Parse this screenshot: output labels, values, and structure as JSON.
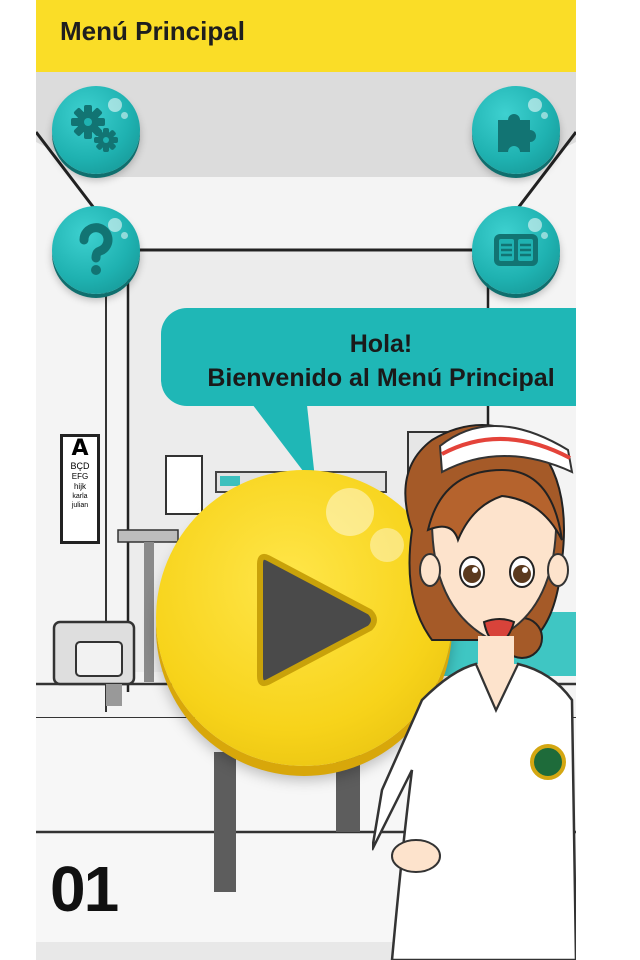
{
  "header": {
    "title": "Menú Principal"
  },
  "buttons": {
    "settings_icon": "gears-icon",
    "puzzle_icon": "puzzle-icon",
    "help_icon": "question-mark-icon",
    "book_icon": "book-icon"
  },
  "speech": {
    "line1": "Hola!",
    "line2": "Bienvenido al Menú Principal"
  },
  "play": {
    "icon": "play-icon"
  },
  "level": {
    "number": "01"
  },
  "chart_text": {
    "lines": [
      "A",
      "BÇD",
      "EFG",
      "hijk",
      "karla",
      "julian"
    ]
  },
  "colors": {
    "header_bg": "#fadd27",
    "teal": "#1fb7b6",
    "play_yellow": "#f7d31a",
    "play_triangle": "#4a4a4a"
  }
}
